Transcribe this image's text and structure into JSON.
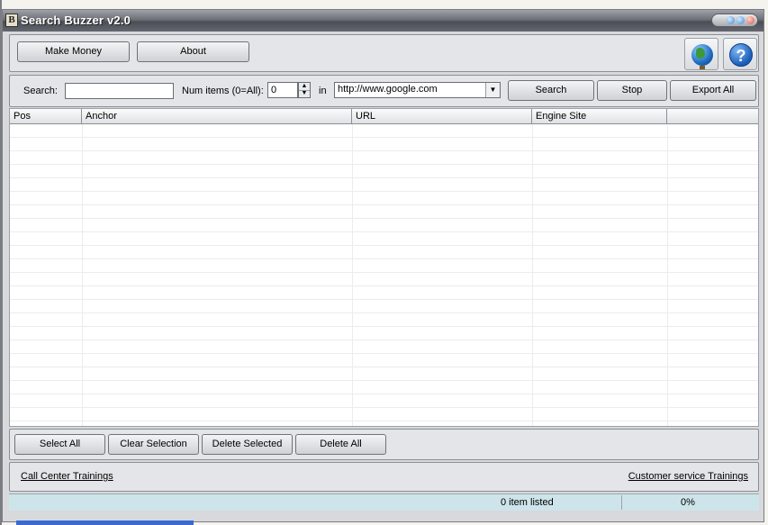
{
  "window": {
    "title": "Search Buzzer v2.0",
    "app_icon_letter": "B"
  },
  "toolbar": {
    "make_money_label": "Make Money",
    "about_label": "About"
  },
  "search_bar": {
    "search_label": "Search:",
    "search_value": "",
    "num_items_label": "Num items (0=All):",
    "num_items_value": "0",
    "in_label": "in",
    "engine_value": "http://www.google.com",
    "search_button": "Search",
    "stop_button": "Stop",
    "export_button": "Export All"
  },
  "table": {
    "columns": [
      "Pos",
      "Anchor",
      "URL",
      "Engine Site",
      ""
    ],
    "rows": []
  },
  "actions": {
    "select_all": "Select All",
    "clear_selection": "Clear Selection",
    "delete_selected": "Delete Selected",
    "delete_all": "Delete All"
  },
  "links": {
    "left": "Call Center Trainings",
    "right": "Customer service Trainings"
  },
  "status": {
    "count_text": "0 item listed",
    "progress_text": "0%"
  },
  "icons": {
    "globe": "globe-icon",
    "help": "help-icon"
  }
}
